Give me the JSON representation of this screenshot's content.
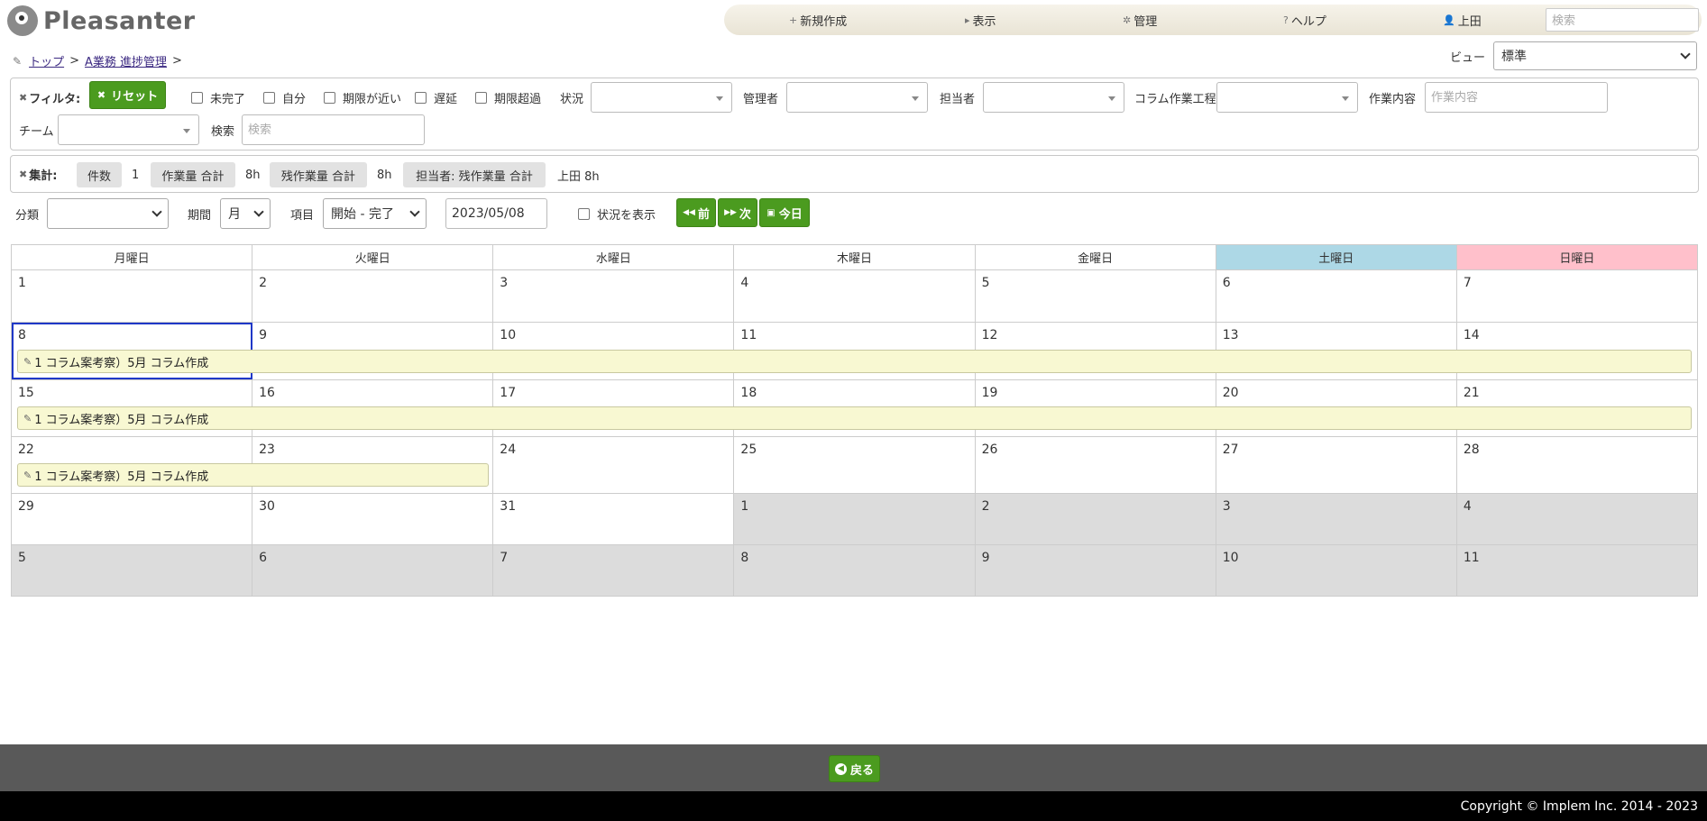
{
  "app": {
    "name": "Pleasanter"
  },
  "nav": {
    "new_label": "新規作成",
    "view_label": "表示",
    "manage_label": "管理",
    "help_label": "ヘルプ",
    "user_label": "上田",
    "search_placeholder": "検索"
  },
  "breadcrumb": {
    "items": [
      "トップ",
      "A業務 進捗管理"
    ],
    "separator": ">"
  },
  "view": {
    "label": "ビュー",
    "selected": "標準"
  },
  "filter": {
    "title": "フィルタ:",
    "reset_label": "リセット",
    "checkboxes": [
      "未完了",
      "自分",
      "期限が近い",
      "遅延",
      "期限超過"
    ],
    "status_label": "状況",
    "manager_label": "管理者",
    "owner_label": "担当者",
    "column_label": "コラム作業工程",
    "work_label": "作業内容",
    "work_placeholder": "作業内容",
    "team_label": "チーム",
    "search_label": "検索",
    "search_placeholder": "検索"
  },
  "summary": {
    "title": "集計:",
    "count_label": "件数",
    "count_value": "1",
    "work_total_label": "作業量 合計",
    "work_total_value": "8h",
    "remain_total_label": "残作業量 合計",
    "remain_total_value": "8h",
    "owner_remain_label": "担当者: 残作業量 合計",
    "owner_remain_value": "上田 8h"
  },
  "toolbar": {
    "category_label": "分類",
    "category_value": "",
    "period_label": "期間",
    "period_value": "月",
    "item_label": "項目",
    "item_value": "開始 - 完了",
    "date_value": "2023/05/08",
    "show_status_label": "状況を表示",
    "prev_label": "前",
    "next_label": "次",
    "today_label": "今日"
  },
  "calendar": {
    "weekdays": [
      "月曜日",
      "火曜日",
      "水曜日",
      "木曜日",
      "金曜日",
      "土曜日",
      "日曜日"
    ],
    "weeks": [
      [
        "1",
        "2",
        "3",
        "4",
        "5",
        "6",
        "7"
      ],
      [
        "8",
        "9",
        "10",
        "11",
        "12",
        "13",
        "14"
      ],
      [
        "15",
        "16",
        "17",
        "18",
        "19",
        "20",
        "21"
      ],
      [
        "22",
        "23",
        "24",
        "25",
        "26",
        "27",
        "28"
      ],
      [
        "29",
        "30",
        "31",
        "1",
        "2",
        "3",
        "4"
      ],
      [
        "5",
        "6",
        "7",
        "8",
        "9",
        "10",
        "11"
      ]
    ],
    "item_label": "1 コラム案考察）5月 コラム作成"
  },
  "footer": {
    "back_label": "戻る",
    "copyright": "Copyright © Implem Inc. 2014 - 2023"
  },
  "colors": {
    "accent_green": "#4b9b1f",
    "saturday": "#add8e6",
    "sunday": "#ffc0cb",
    "item_bg": "#f8f8d2"
  }
}
